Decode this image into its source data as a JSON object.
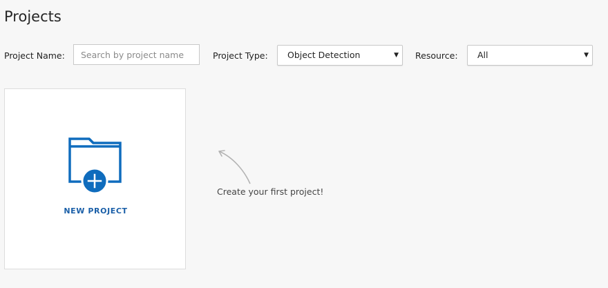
{
  "page": {
    "title": "Projects"
  },
  "filters": {
    "project_name_label": "Project Name:",
    "project_name_placeholder": "Search by project name",
    "project_name_value": "",
    "project_type_label": "Project Type:",
    "project_type_value": "Object Detection",
    "resource_label": "Resource:",
    "resource_value": "All"
  },
  "new_project_card": {
    "label": "NEW PROJECT",
    "icon": "folder-plus-icon"
  },
  "hint": {
    "text": "Create your first project!",
    "icon": "curved-arrow-icon"
  },
  "colors": {
    "accent": "#0f6cbd",
    "background": "#f7f7f7",
    "card_background": "#ffffff"
  }
}
